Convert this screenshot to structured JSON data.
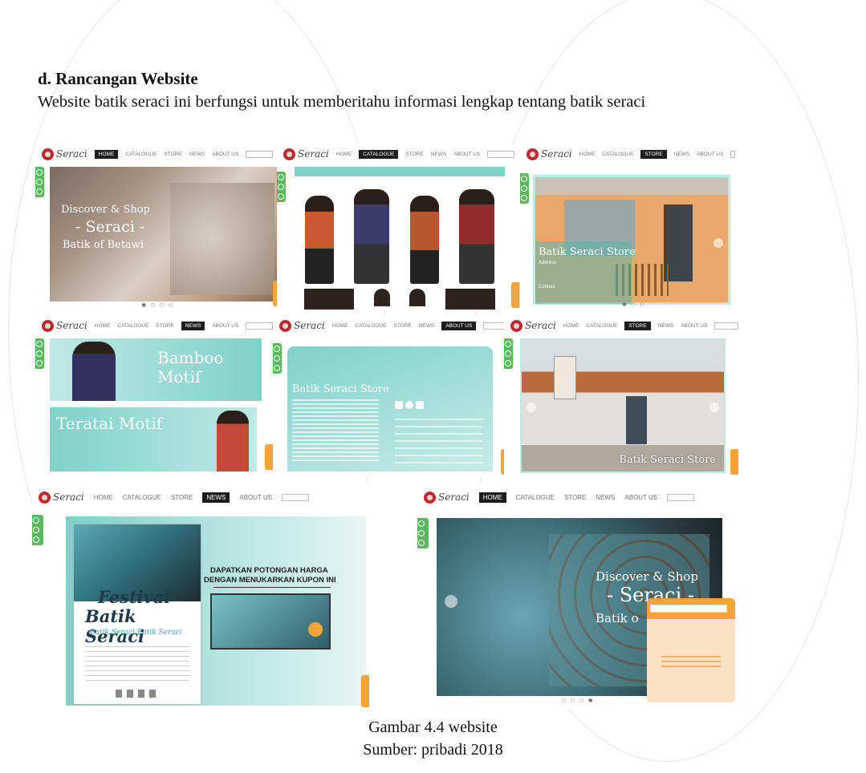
{
  "section": {
    "heading": "d. Rancangan Website",
    "intro": "Website batik seraci ini berfungsi untuk memberitahu informasi lengkap tentang batik seraci"
  },
  "caption": {
    "title": "Gambar 4.4 website",
    "source": "Sumber: pribadi 2018"
  },
  "colors": {
    "teal": "#7fd1ca",
    "teal_light": "#bfe9e4",
    "orange": "#f4a43a",
    "green": "#5cb85c",
    "logo_red": "#c1272d",
    "nav_dark": "#1d1d1d"
  },
  "icons": [
    "logo-mark-icon",
    "download-icon",
    "chat-icon",
    "cart-icon",
    "arrow-left-icon",
    "arrow-right-icon",
    "social-icons"
  ],
  "screens": {
    "home_hero": {
      "logo": "Seraci",
      "nav": [
        "HOME",
        "CATALOGUE",
        "STORE",
        "NEWS",
        "ABOUT US"
      ],
      "active": "HOME",
      "hero_line1": "Discover & Shop",
      "hero_line2": "- Seraci -",
      "hero_line3": "Batik of Betawi"
    },
    "catalogue": {
      "logo": "Seraci",
      "nav": [
        "HOME",
        "CATALOGUE",
        "STORE",
        "NEWS",
        "ABOUT US"
      ],
      "active": "CATALOGUE"
    },
    "store_front": {
      "logo": "Seraci",
      "nav": [
        "HOME",
        "CATALOGUE",
        "STORE",
        "NEWS",
        "ABOUT US"
      ],
      "active": "STORE",
      "title": "Batik Seraci Store",
      "address_label": "Address",
      "contact_label": "Contact"
    },
    "news_motif": {
      "logo": "Seraci",
      "nav": [
        "HOME",
        "CATALOGUE",
        "STORE",
        "NEWS",
        "ABOUT US"
      ],
      "active": "NEWS",
      "banner1": "Bamboo Motif",
      "banner2": "Teratai Motif"
    },
    "about_store": {
      "logo": "Seraci",
      "nav": [
        "HOME",
        "CATALOGUE",
        "STORE",
        "NEWS",
        "ABOUT US"
      ],
      "active": "ABOUT US",
      "title": "Batik Seraci Store"
    },
    "store_building": {
      "logo": "Seraci",
      "nav": [
        "HOME",
        "CATALOGUE",
        "STORE",
        "NEWS",
        "ABOUT US"
      ],
      "active": "STORE",
      "title": "Batik Seraci Store"
    },
    "news_festival": {
      "logo": "Seraci",
      "nav": [
        "HOME",
        "CATALOGUE",
        "STORE",
        "NEWS",
        "ABOUT US"
      ],
      "active": "NEWS",
      "poster_line1": "Festival",
      "poster_line2": "Batik Seraci",
      "poster_line3": "Batik Seraci   Batik Seraci",
      "promo_line1": "DAPATKAN POTONGAN HARGA",
      "promo_line2": "DENGAN MENUKARKAN KUPON INI"
    },
    "home_chat": {
      "logo": "Seraci",
      "nav": [
        "HOME",
        "CATALOGUE",
        "STORE",
        "NEWS",
        "ABOUT US"
      ],
      "active": "HOME",
      "hero_line1": "Discover & Shop",
      "hero_line2": "- Seraci -",
      "hero_line3": "Batik o"
    }
  }
}
